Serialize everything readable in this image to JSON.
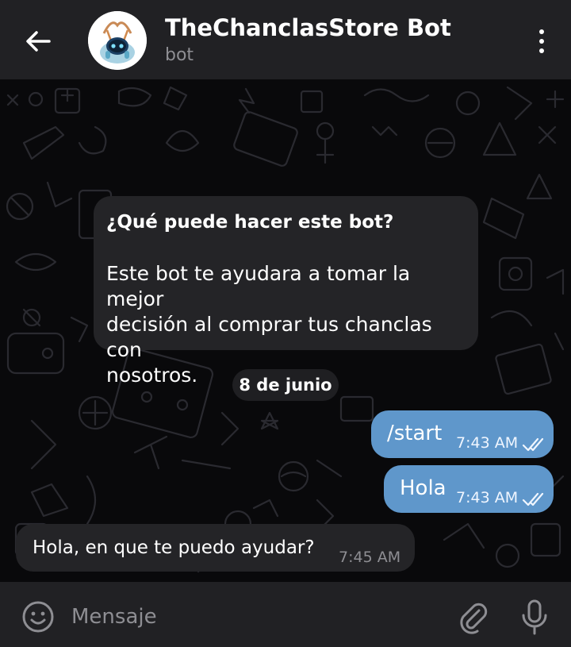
{
  "header": {
    "title": "TheChanclasStore Bot",
    "subtitle": "bot",
    "back_icon": "arrow-left-icon",
    "more_icon": "more-vertical-icon",
    "avatar_icon": "robot-avatar-icon"
  },
  "bot_info": {
    "title": "¿Qué puede hacer este bot?",
    "description": "Este bot te ayudara a tomar la mejor\ndecisión al comprar tus chanclas con\nnosotros."
  },
  "date_divider": "8 de junio",
  "messages": [
    {
      "direction": "outgoing",
      "text": "/start",
      "time": "7:43 AM",
      "status_icon": "double-check-icon"
    },
    {
      "direction": "outgoing",
      "text": "Hola",
      "time": "7:43 AM",
      "status_icon": "double-check-icon"
    },
    {
      "direction": "incoming",
      "text": "Hola, en que te puedo ayudar?",
      "time": "7:45 AM"
    }
  ],
  "input": {
    "placeholder": "Mensaje",
    "emoji_icon": "emoji-icon",
    "attach_icon": "paperclip-icon",
    "mic_icon": "microphone-icon"
  },
  "colors": {
    "header_bg": "#212124",
    "chat_bg": "#09090b",
    "outgoing_bubble": "#5f97cb",
    "incoming_bubble": "#242427",
    "secondary_text": "#8e8e93"
  }
}
